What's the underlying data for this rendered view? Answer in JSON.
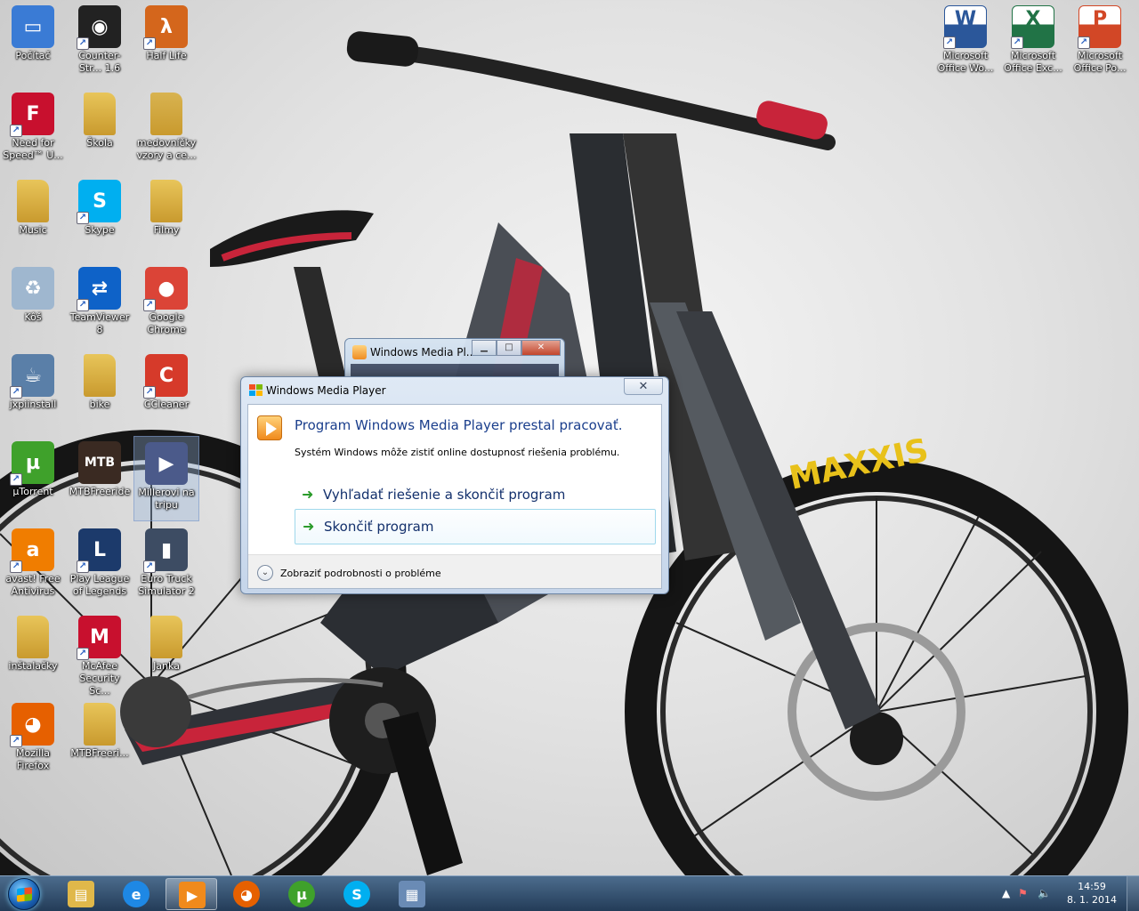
{
  "desktop_icons": [
    {
      "label": "Počítač",
      "icon": "computer-icon",
      "color": "#3a7bd5",
      "glyph": "▭",
      "shortcut": false
    },
    {
      "label": "Counter-Str... 1.6",
      "icon": "counter-strike-icon",
      "color": "#222222",
      "glyph": "◉",
      "shortcut": true
    },
    {
      "label": "Half Life",
      "icon": "half-life-icon",
      "color": "#d4661c",
      "glyph": "λ",
      "shortcut": true
    },
    {
      "label": "Need for Speed™ U...",
      "icon": "need-for-speed-icon",
      "color": "#c8102e",
      "glyph": "F",
      "shortcut": true
    },
    {
      "label": "Škola",
      "icon": "folder-icon",
      "color": "#e8c55a",
      "glyph": "",
      "shortcut": false
    },
    {
      "label": "medovníčky vzory a ce...",
      "icon": "folder-icon",
      "color": "#d8b350",
      "glyph": "",
      "shortcut": false
    },
    {
      "label": "Music",
      "icon": "folder-icon",
      "color": "#e8c55a",
      "glyph": "",
      "shortcut": false
    },
    {
      "label": "Skype",
      "icon": "skype-icon",
      "color": "#00aff0",
      "glyph": "S",
      "shortcut": true
    },
    {
      "label": "Filmy",
      "icon": "folder-icon",
      "color": "#e8c55a",
      "glyph": "",
      "shortcut": false
    },
    {
      "label": "Kôš",
      "icon": "recycle-bin-icon",
      "color": "#9fb7cf",
      "glyph": "♻",
      "shortcut": false
    },
    {
      "label": "TeamViewer 8",
      "icon": "teamviewer-icon",
      "color": "#0e62c8",
      "glyph": "⇄",
      "shortcut": true
    },
    {
      "label": "Google Chrome",
      "icon": "chrome-icon",
      "color": "#db4437",
      "glyph": "●",
      "shortcut": true
    },
    {
      "label": "jxpiinstall",
      "icon": "java-installer-icon",
      "color": "#5a7fa8",
      "glyph": "☕",
      "shortcut": true
    },
    {
      "label": "bike",
      "icon": "folder-icon",
      "color": "#e8c55a",
      "glyph": "",
      "shortcut": false
    },
    {
      "label": "CCleaner",
      "icon": "ccleaner-icon",
      "color": "#d63a2a",
      "glyph": "C",
      "shortcut": true
    },
    {
      "label": "µTorrent",
      "icon": "utorrent-icon",
      "color": "#3fa12b",
      "glyph": "µ",
      "shortcut": true
    },
    {
      "label": "MTBFreeride",
      "icon": "mtb-freeride-icon",
      "color": "#3a2a22",
      "glyph": "MTB",
      "shortcut": false
    },
    {
      "label": "Millerovi na tripu",
      "icon": "video-file-icon",
      "color": "#4b5a8a",
      "glyph": "▶",
      "shortcut": false
    },
    {
      "label": "avast! Free Antivirus",
      "icon": "avast-icon",
      "color": "#f07d00",
      "glyph": "a",
      "shortcut": true
    },
    {
      "label": "Play League of Legends",
      "icon": "league-of-legends-icon",
      "color": "#1c3a6b",
      "glyph": "L",
      "shortcut": true
    },
    {
      "label": "Euro Truck Simulator 2",
      "icon": "euro-truck-icon",
      "color": "#3d4c63",
      "glyph": "▮",
      "shortcut": true
    },
    {
      "label": "inštalačky",
      "icon": "folder-icon",
      "color": "#e8c55a",
      "glyph": "",
      "shortcut": false
    },
    {
      "label": "McAfee Security Sc...",
      "icon": "mcafee-icon",
      "color": "#c8102e",
      "glyph": "M",
      "shortcut": true
    },
    {
      "label": "Janka",
      "icon": "folder-icon",
      "color": "#e8c55a",
      "glyph": "",
      "shortcut": false
    },
    {
      "label": "Mozilla Firefox",
      "icon": "firefox-icon",
      "color": "#e66000",
      "glyph": "◕",
      "shortcut": true
    },
    {
      "label": "MTBFreeri...",
      "icon": "folder-icon",
      "color": "#e8c55a",
      "glyph": "",
      "shortcut": false
    }
  ],
  "office_icons": [
    {
      "label": "Microsoft Office Wo...",
      "icon": "word-icon",
      "color": "#2b579a",
      "glyph": "W"
    },
    {
      "label": "Microsoft Office Exc...",
      "icon": "excel-icon",
      "color": "#217346",
      "glyph": "X"
    },
    {
      "label": "Microsoft Office Po...",
      "icon": "powerpoint-icon",
      "color": "#d24726",
      "glyph": "P"
    }
  ],
  "back_window": {
    "title": "Windows Media Pl..."
  },
  "dialog": {
    "title": "Windows Media Player",
    "close_label": "✕",
    "heading": "Program Windows Media Player prestal pracovať.",
    "subtext": "Systém Windows môže zistiť online dostupnosť riešenia problému.",
    "option_search": "Vyhľadať riešenie a skončiť program",
    "option_close": "Skončiť program",
    "details_label": "Zobraziť podrobnosti o probléme"
  },
  "taskbar": {
    "pinned": [
      {
        "icon": "explorer-icon",
        "color": "#e0b84a",
        "glyph": "▤",
        "active": false
      },
      {
        "icon": "internet-explorer-icon",
        "color": "#1e88e5",
        "glyph": "e",
        "active": false
      },
      {
        "icon": "windows-media-player-icon",
        "color": "#f08a1c",
        "glyph": "▶",
        "active": true
      },
      {
        "icon": "firefox-icon",
        "color": "#e66000",
        "glyph": "◕",
        "active": false
      },
      {
        "icon": "utorrent-icon",
        "color": "#3fa12b",
        "glyph": "µ",
        "active": false
      },
      {
        "icon": "skype-icon",
        "color": "#00aff0",
        "glyph": "S",
        "active": false
      },
      {
        "icon": "control-panel-icon",
        "color": "#6a8bb5",
        "glyph": "▦",
        "active": false
      }
    ],
    "time": "14:59",
    "date": "8. 1. 2014"
  }
}
